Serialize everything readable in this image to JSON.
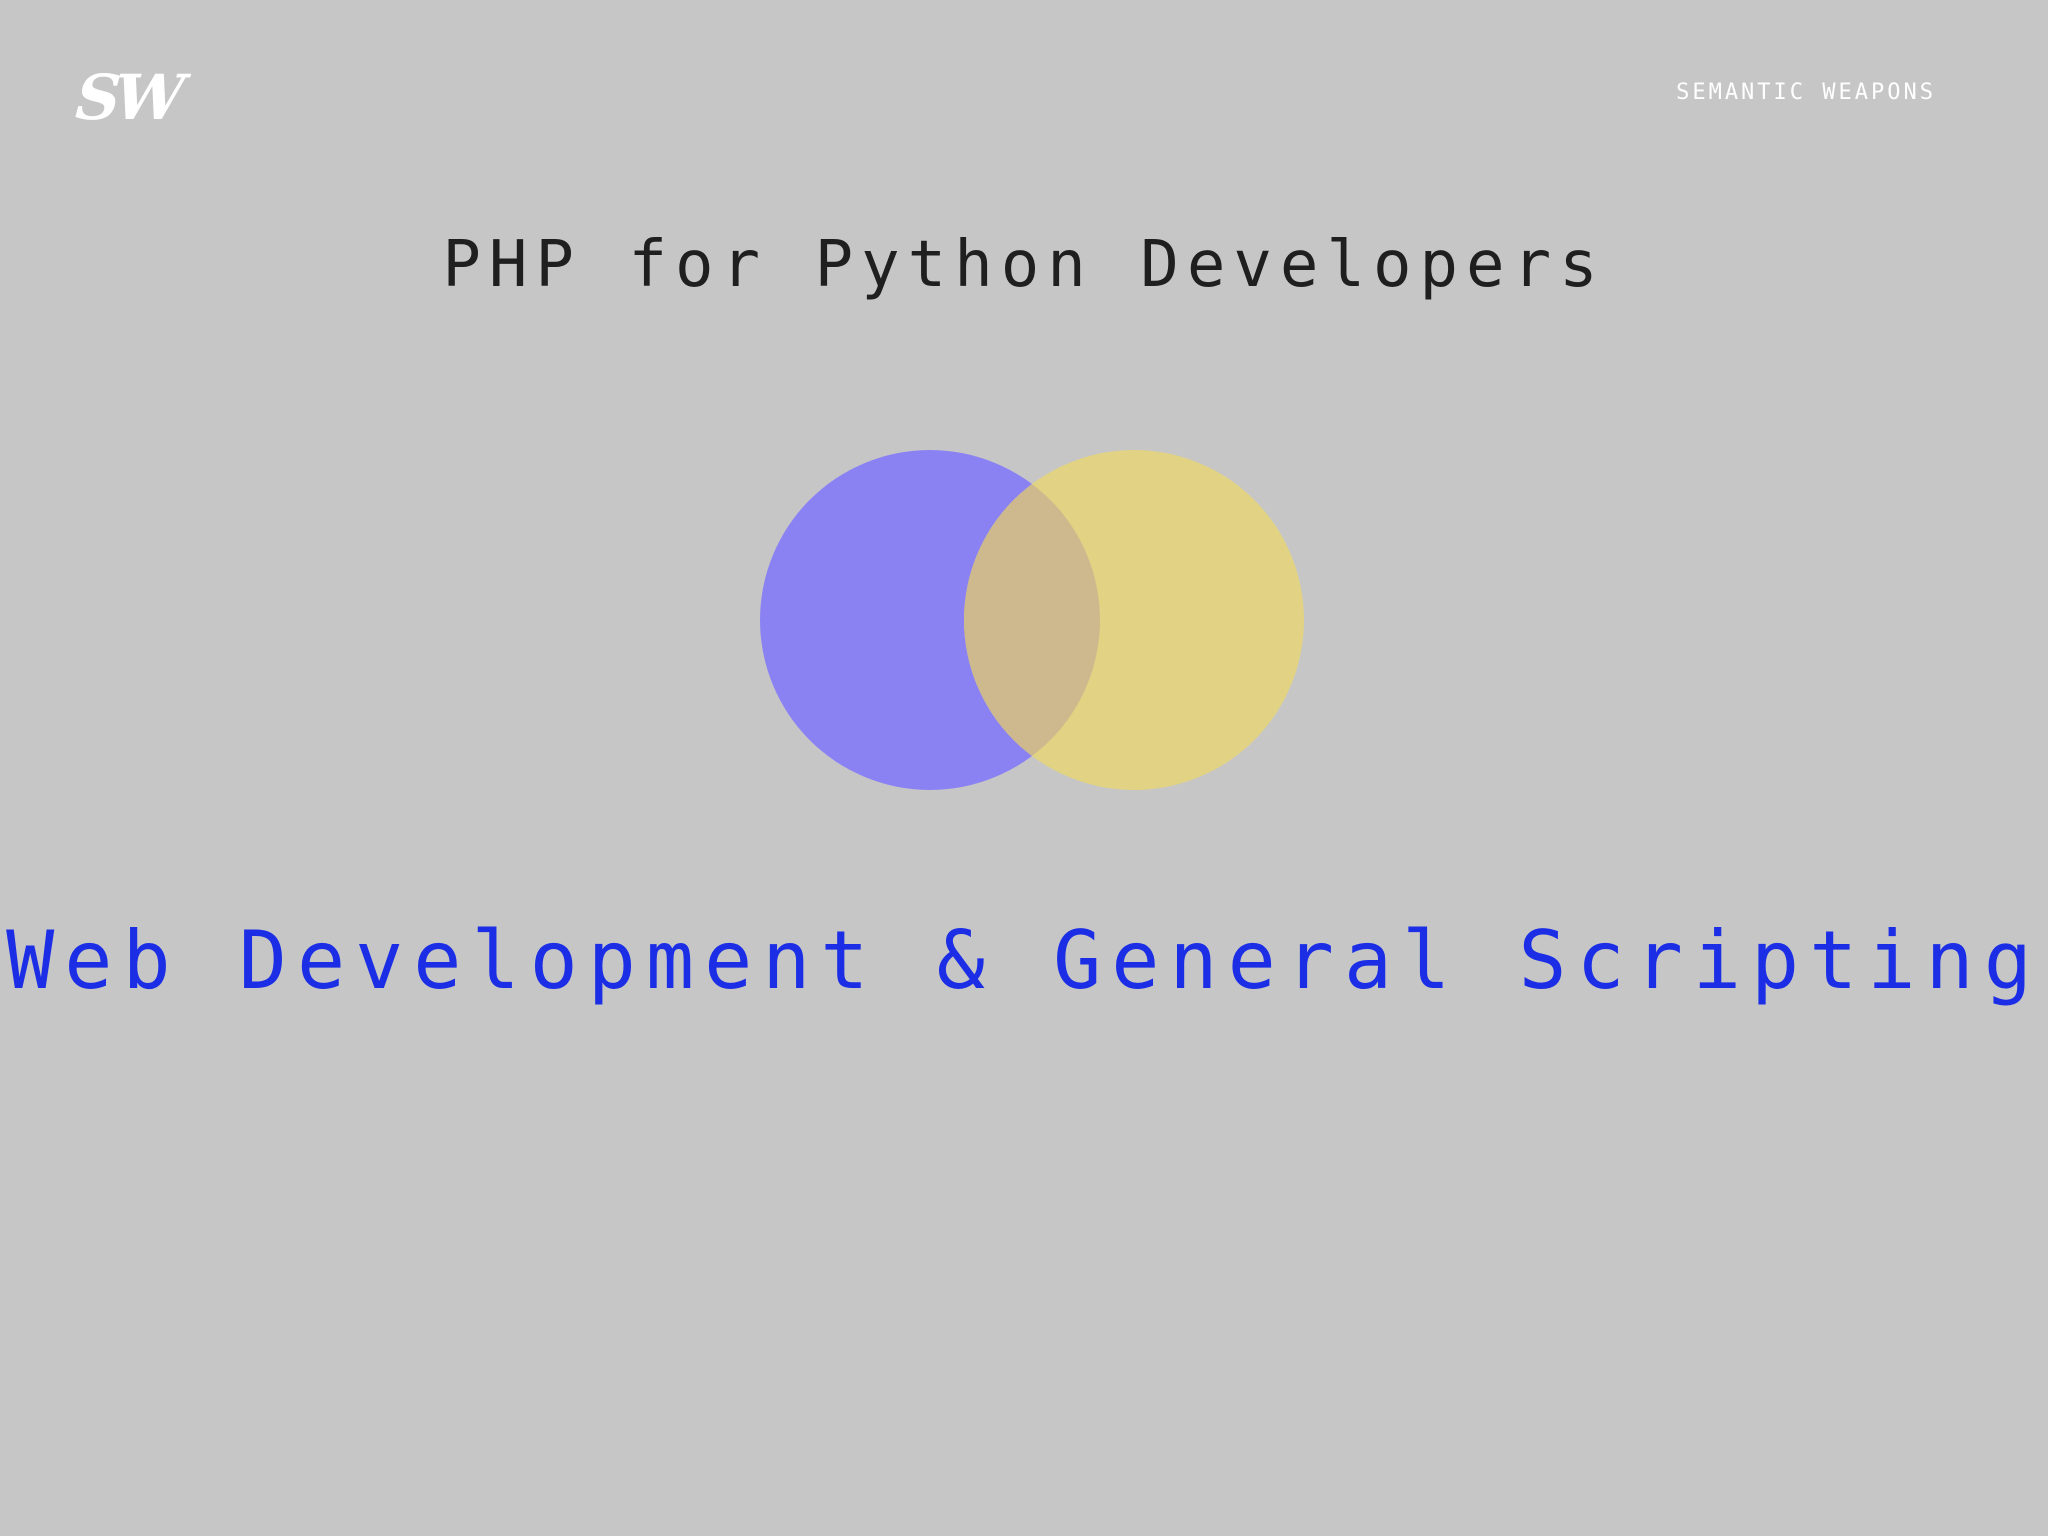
{
  "header": {
    "logo_text": "SW",
    "brand_name": "SEMANTIC WEAPONS"
  },
  "slide": {
    "title": "PHP for Python Developers",
    "subtitle": "Web Development & General Scripting"
  },
  "venn": {
    "left_color": "#8a82f3",
    "right_color": "#e1d383",
    "overlap_color": "#cdb98d"
  },
  "colors": {
    "background": "#c6c6c7",
    "title": "#1f1f1f",
    "subtitle": "#1b2ee6",
    "brand": "#ffffff"
  }
}
